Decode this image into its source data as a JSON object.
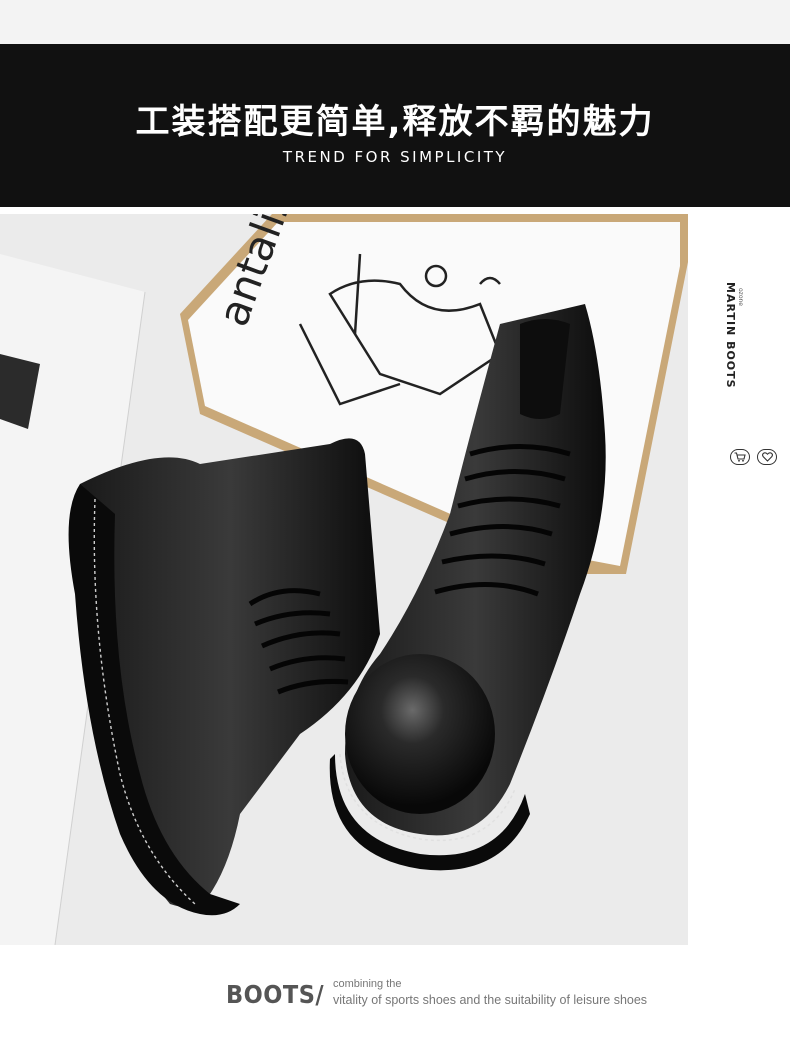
{
  "banner": {
    "headline": "工装搭配更简单,释放不羁的魅力",
    "subheadline": "TREND FOR SIMPLICITY"
  },
  "side": {
    "label": "MARTIN BOOTS",
    "small_text": "ozone"
  },
  "icons": {
    "cart": "cart-icon",
    "favorite": "heart-icon"
  },
  "artwork": {
    "text": "antaliz"
  },
  "footer": {
    "title": "BOOTS/",
    "line1": "combining the",
    "line2": "vitality of sports shoes and the suitability of leisure shoes"
  },
  "colors": {
    "banner_bg": "#111111",
    "banner_text": "#ffffff",
    "footer_text": "#777777"
  }
}
